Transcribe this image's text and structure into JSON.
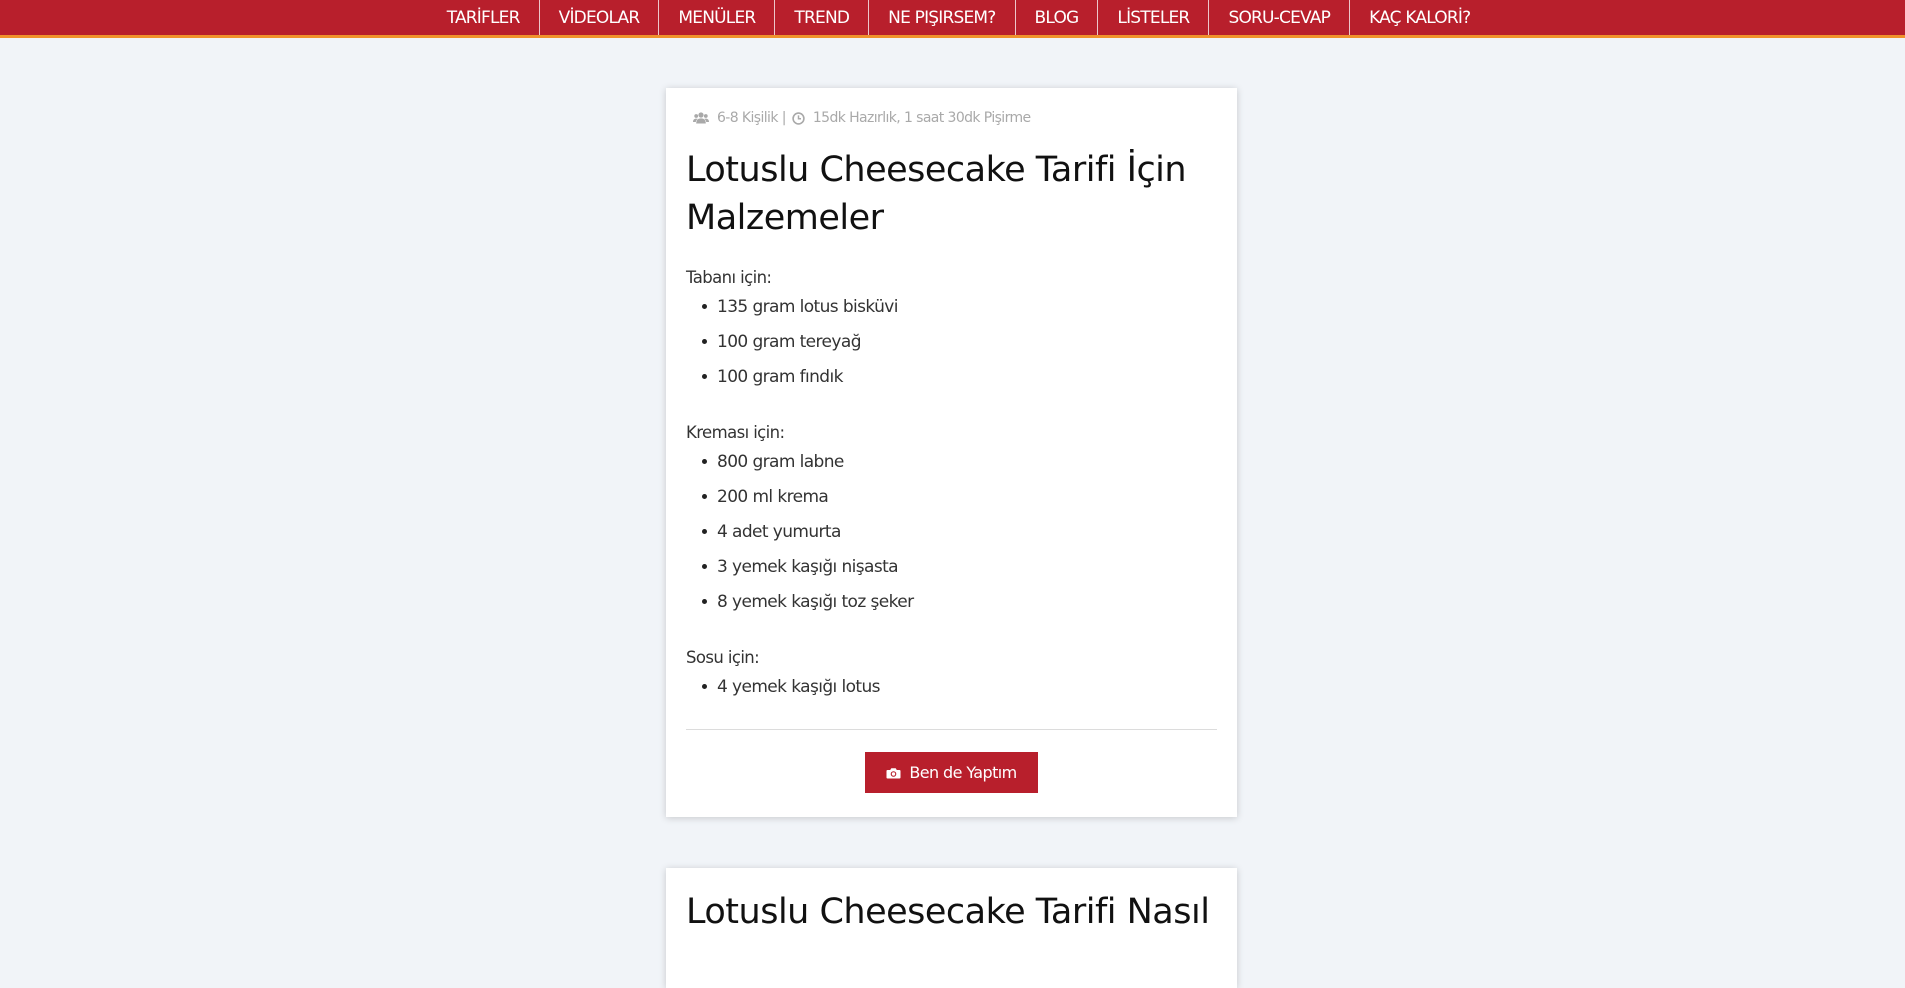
{
  "nav": {
    "items": [
      "TARİFLER",
      "VİDEOLAR",
      "MENÜLER",
      "TREND",
      "NE PIŞIRSEM?",
      "BLOG",
      "LİSTELER",
      "SORU-CEVAP",
      "KAÇ KALORİ?"
    ]
  },
  "recipe": {
    "servings": "6-8 Kişilik |",
    "time": "15dk Hazırlık, 1 saat 30dk Pişirme",
    "ingredients_title": "Lotuslu Cheesecake Tarifi İçin Malzemeler",
    "sections": [
      {
        "label": "Tabanı için:",
        "items": [
          "135 gram lotus bisküvi",
          "100 gram tereyağ",
          "100 gram fındık"
        ]
      },
      {
        "label": "Kreması için:",
        "items": [
          "800 gram labne",
          "200 ml krema",
          "4 adet yumurta",
          "3 yemek kaşığı nişasta",
          "8 yemek kaşığı toz şeker"
        ]
      },
      {
        "label": "Sosu için:",
        "items": [
          "4 yemek kaşığı lotus"
        ]
      }
    ],
    "made_it_button": "Ben de Yaptım",
    "next_title": "Lotuslu Cheesecake Tarifi Nasıl"
  },
  "colors": {
    "brand_red": "#b81f2c",
    "nav_accent": "#f0922b",
    "background": "#f1f4f8"
  },
  "icons": {
    "servings": "users-icon",
    "time": "clock-icon",
    "button": "camera-icon"
  }
}
